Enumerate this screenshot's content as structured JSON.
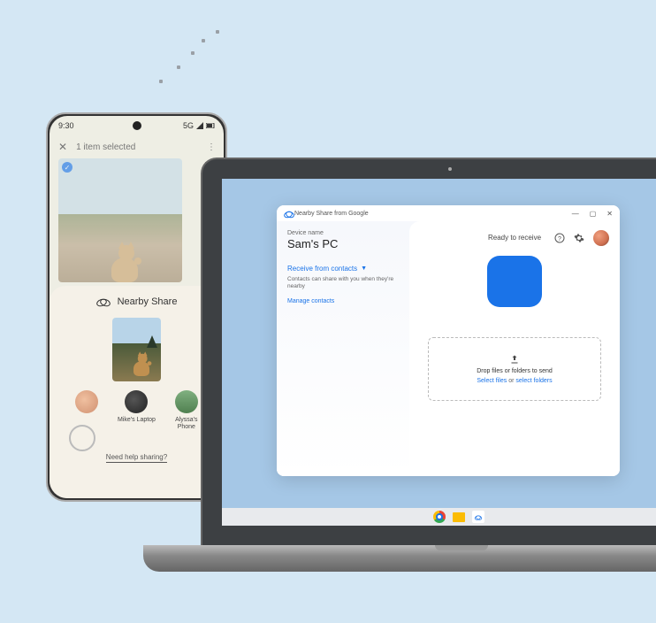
{
  "phone": {
    "status": {
      "time": "9:30",
      "network": "5G"
    },
    "toolbar": {
      "selected": "1 item selected"
    },
    "sheet": {
      "title": "Nearby Share",
      "targets": [
        {
          "name": ""
        },
        {
          "name": "Mike's Laptop"
        },
        {
          "name": "Alyssa's Phone"
        }
      ],
      "help": "Need help sharing?"
    }
  },
  "laptop": {
    "window": {
      "title": "Nearby Share from Google",
      "device_label": "Device name",
      "device_name": "Sam's PC",
      "receive_label": "Receive from contacts",
      "receive_sub": "Contacts can share with you when they're nearby",
      "manage": "Manage contacts",
      "ready": "Ready to receive",
      "drop_label": "Drop files or folders to send",
      "select_files": "Select files",
      "or": "or",
      "select_folders": "select folders"
    }
  }
}
